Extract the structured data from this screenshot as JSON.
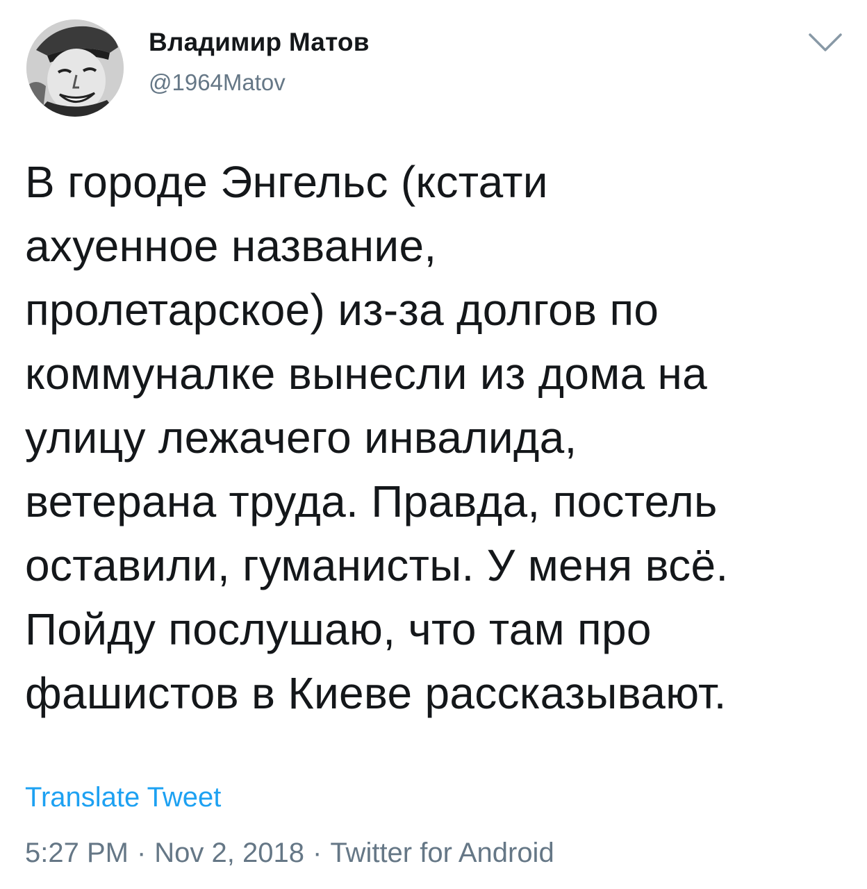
{
  "author": {
    "name": "Владимир Матов",
    "handle": "@1964Matov"
  },
  "tweet": {
    "lines": [
      "В городе Энгельс (кстати",
      "ахуенное название,",
      "пролетарское) из-за долгов по",
      "коммуналке вынесли из дома на",
      "улицу лежачего инвалида,",
      "ветерана труда. Правда, постель",
      "оставили, гуманисты. У меня всё.",
      "Пойду послушаю, что там про",
      "фашистов в Киеве рассказывают."
    ]
  },
  "actions": {
    "translate_label": "Translate Tweet"
  },
  "meta": {
    "time": "5:27 PM",
    "separator": "·",
    "date": "Nov 2, 2018",
    "source": "Twitter for Android"
  },
  "icons": {
    "avatar": "avatar-photo",
    "menu": "chevron-down-icon"
  },
  "colors": {
    "text": "#14171a",
    "secondary": "#657786",
    "link": "#1da1f2",
    "background": "#ffffff"
  }
}
